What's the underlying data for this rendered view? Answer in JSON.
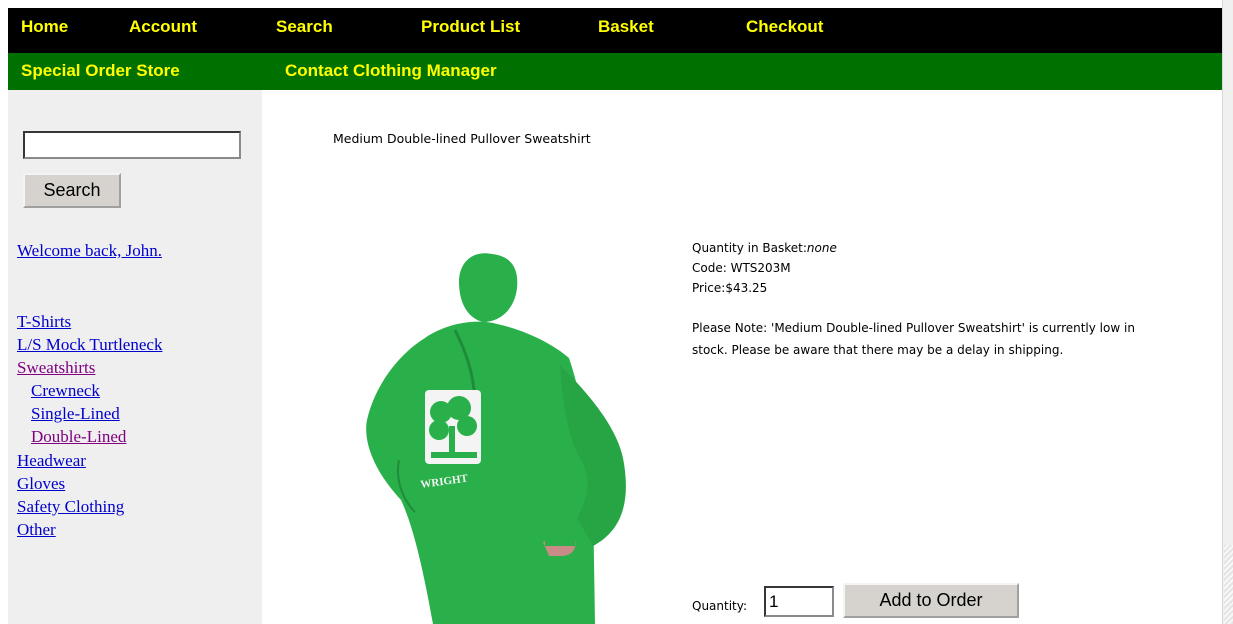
{
  "nav": {
    "home": "Home",
    "account": "Account",
    "search": "Search",
    "product_list": "Product List",
    "basket": "Basket",
    "checkout": "Checkout"
  },
  "subnav": {
    "special_order": "Special Order Store",
    "contact": "Contact Clothing Manager"
  },
  "sidebar": {
    "search_value": "",
    "search_button": "Search",
    "welcome": "Welcome back, John.",
    "categories": {
      "tshirts": "T-Shirts",
      "turtleneck": "L/S Mock Turtleneck",
      "sweatshirts": "Sweatshirts",
      "crewneck": "Crewneck",
      "single_lined": "Single-Lined",
      "double_lined": "Double-Lined",
      "headwear": "Headwear",
      "gloves": "Gloves",
      "safety": "Safety Clothing",
      "other": "Other"
    }
  },
  "product": {
    "title": "Medium Double-lined Pullover Sweatshirt",
    "qty_in_basket_label": "Quantity in Basket:",
    "qty_in_basket_value": "none",
    "code_label": "Code: ",
    "code_value": "WTS203M",
    "price_label": "Price:",
    "price_value": "$43.25",
    "note_line1": "Please Note: 'Medium Double-lined Pullover Sweatshirt' is currently low in",
    "note_line2": "stock. Please be aware that there may be a delay in shipping.",
    "image_logo_text": "WRIGHT"
  },
  "order": {
    "quantity_label": "Quantity:",
    "quantity_value": "1",
    "add_button": "Add to Order"
  },
  "colors": {
    "top_bar": "#000000",
    "sub_bar": "#007000",
    "nav_text": "#ffff00",
    "sidebar_bg": "#efefef",
    "link": "#0000cc",
    "visited_link": "#800080",
    "sweatshirt": "#2ab04a"
  }
}
